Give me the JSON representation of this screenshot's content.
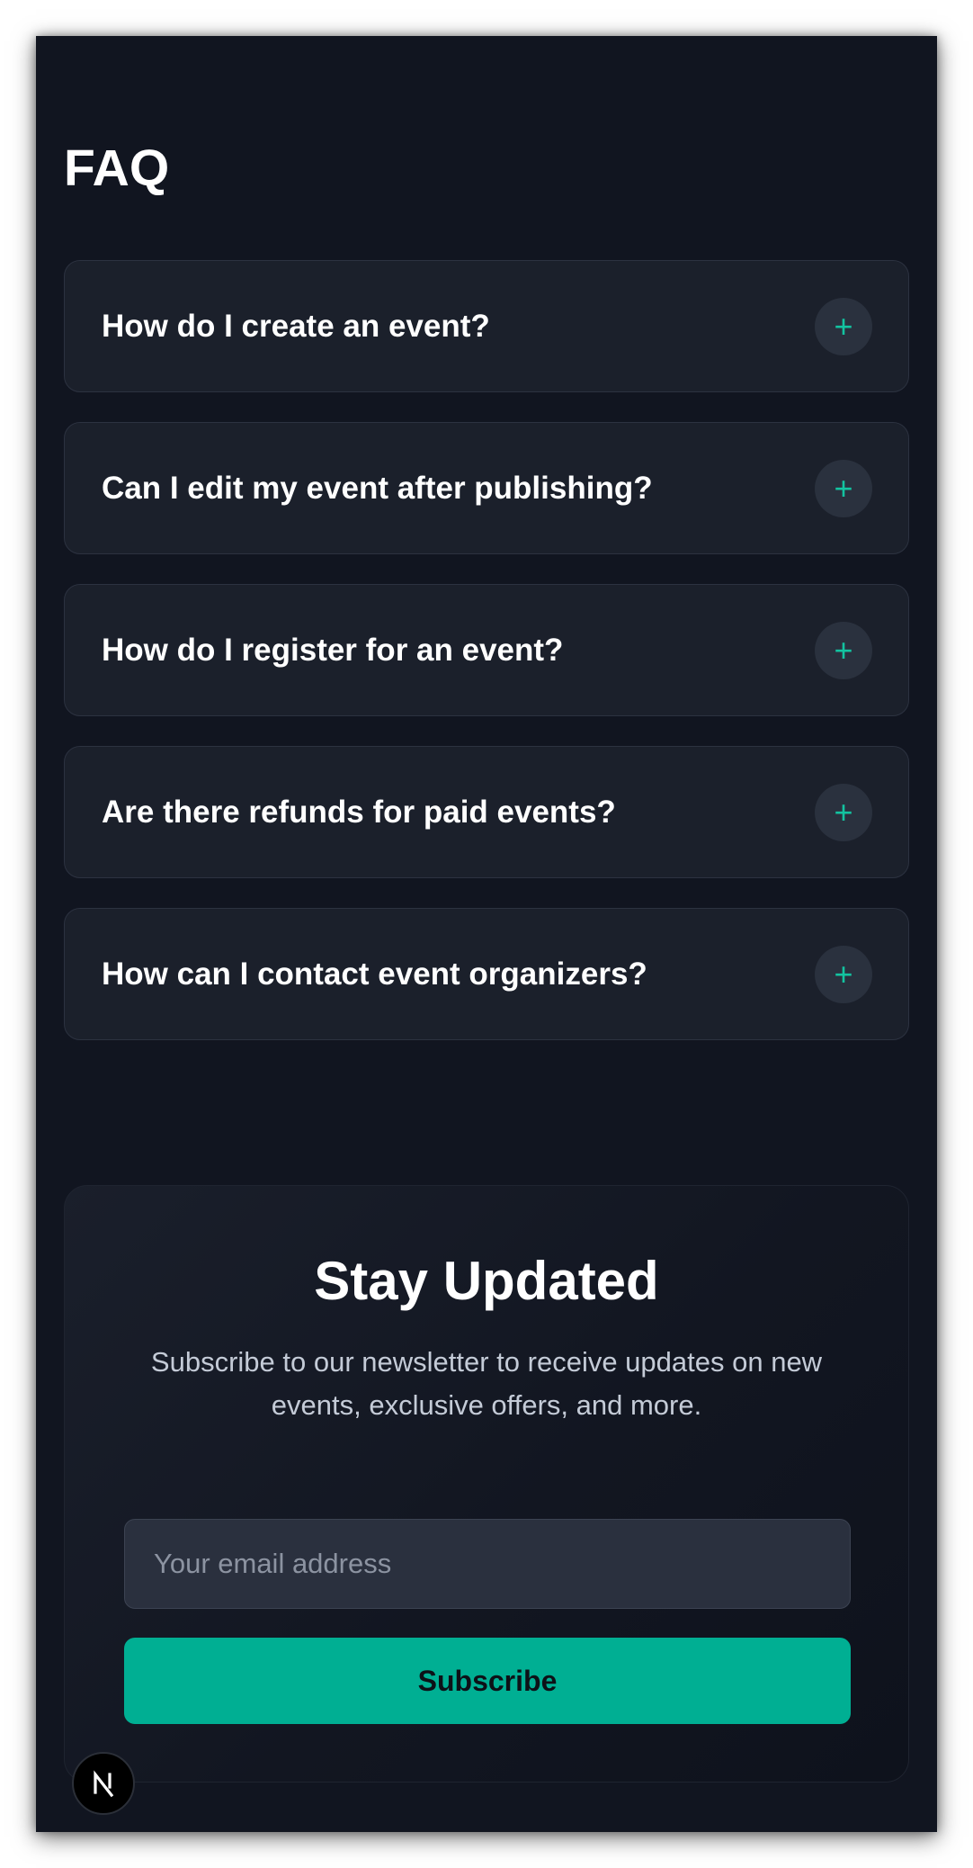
{
  "faq": {
    "title": "FAQ",
    "items": [
      {
        "question": "How do I create an event?"
      },
      {
        "question": "Can I edit my event after publishing?"
      },
      {
        "question": "How do I register for an event?"
      },
      {
        "question": "Are there refunds for paid events?"
      },
      {
        "question": "How can I contact event organizers?"
      }
    ],
    "toggle_symbol": "+"
  },
  "newsletter": {
    "title": "Stay Updated",
    "description": "Subscribe to our newsletter to receive updates on new events, exclusive offers, and more.",
    "email_placeholder": "Your email address",
    "email_value": "",
    "button_label": "Subscribe"
  },
  "dev_badge": {
    "icon": "nextjs-logo-icon"
  },
  "colors": {
    "background": "#111520",
    "card": "#1b202b",
    "accent": "#00af93",
    "plus_icon": "#13c3a0"
  }
}
